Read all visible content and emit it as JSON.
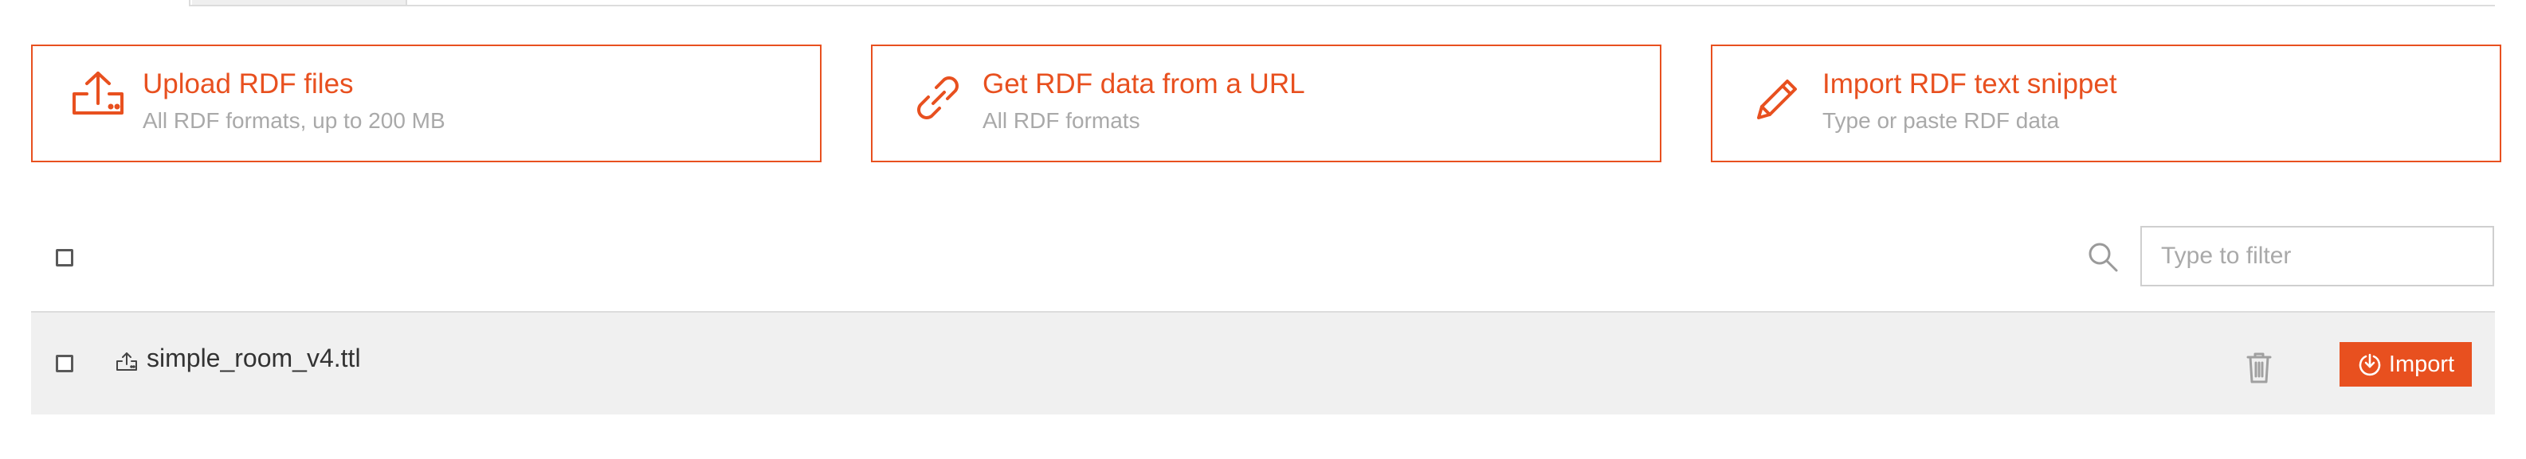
{
  "cards": [
    {
      "title": "Upload RDF files",
      "subtitle": "All RDF formats, up to 200 MB",
      "icon": "upload-icon"
    },
    {
      "title": "Get RDF data from a URL",
      "subtitle": "All RDF formats",
      "icon": "link-icon"
    },
    {
      "title": "Import RDF text snippet",
      "subtitle": "Type or paste RDF data",
      "icon": "pencil-icon"
    }
  ],
  "filter": {
    "placeholder": "Type to filter",
    "value": ""
  },
  "files": [
    {
      "name": "simple_room_v4.ttl",
      "selected": false,
      "action_label": "Import"
    }
  ],
  "colors": {
    "accent": "#e8501f",
    "muted_text": "#a9a9a9",
    "row_bg": "#f0f0f0"
  }
}
